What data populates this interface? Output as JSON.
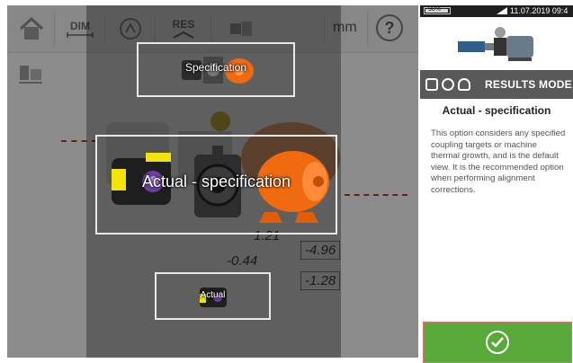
{
  "toolbar": {
    "home_icon": "home-icon",
    "dimensions_label": "DIM",
    "results_label": "RES",
    "unit_label": "mm",
    "help_label": "?"
  },
  "background_values": {
    "value_a": "-4.96",
    "value_b": "-0.44",
    "value_c": "-1.28",
    "value_d": "1.21"
  },
  "options": {
    "top_label": "Specification",
    "main_label": "Actual - specification",
    "bottom_label": "Actual"
  },
  "status_bar": {
    "battery": "98%",
    "battery_level": 0.98,
    "clock": "11.07.2019 09:4"
  },
  "help_pane": {
    "mode_title": "RESULTS MODE",
    "heading": "Actual - specification",
    "body": "This option considers any specified coupling targets or machine thermal growth, and is the default view. It is the recommended option when performing alignment corrections."
  },
  "colors": {
    "accent_green": "#58a83a",
    "mode_bar": "#595959",
    "motor_orange": "#f06a10",
    "sensor_yellow": "#f2e30a"
  }
}
